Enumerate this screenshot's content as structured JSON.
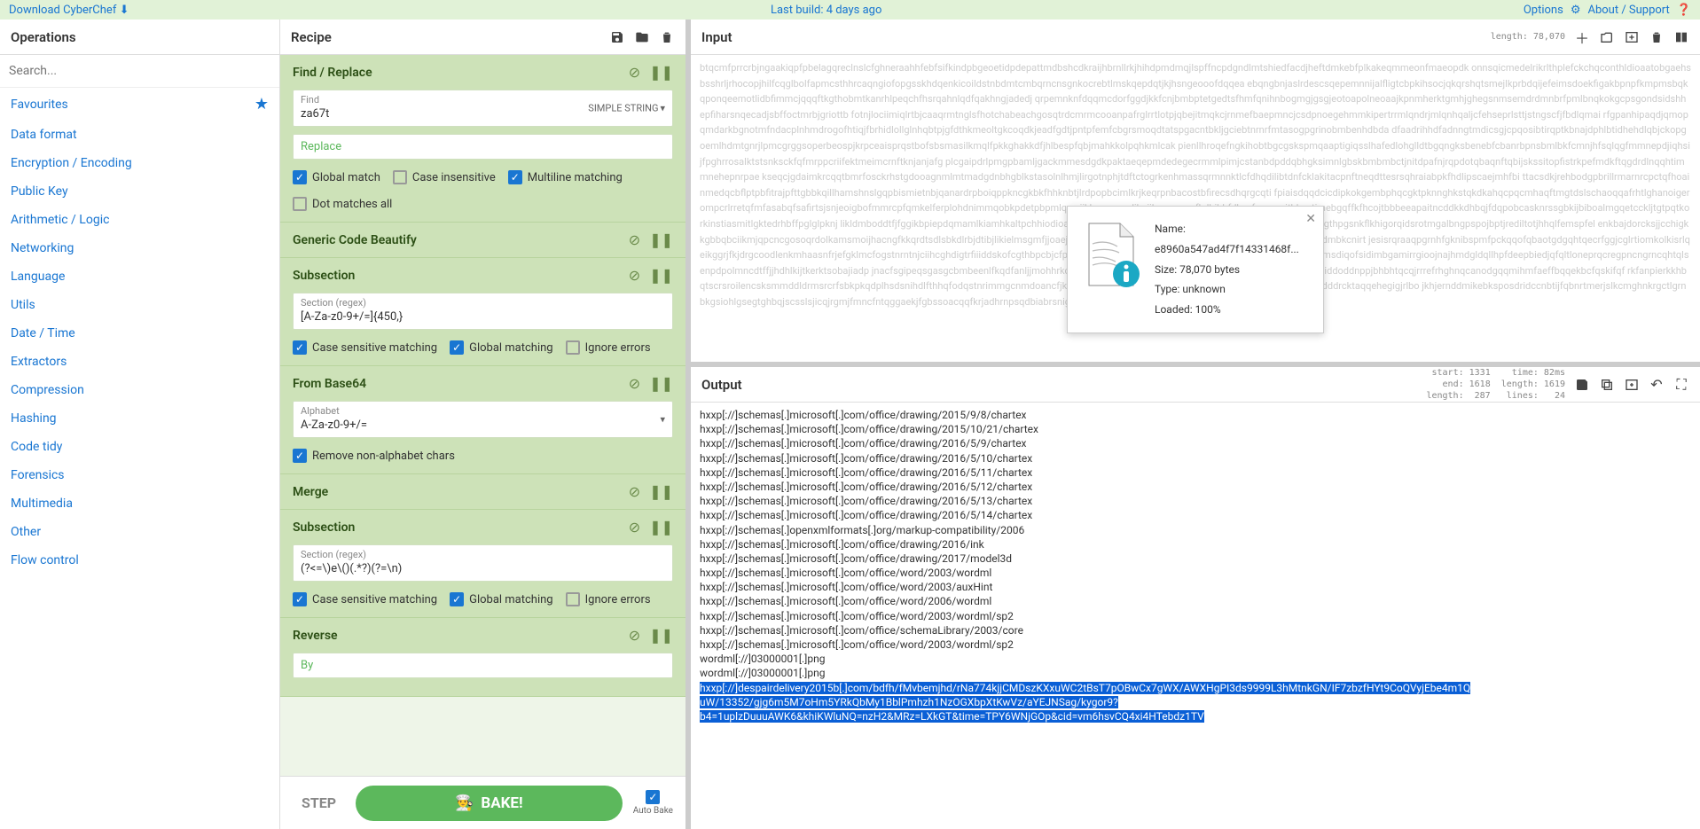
{
  "topbar": {
    "download": "Download CyberChef",
    "last_build": "Last build: 4 days ago",
    "options": "Options",
    "about": "About / Support"
  },
  "ops": {
    "title": "Operations",
    "search_placeholder": "Search...",
    "categories": [
      "Favourites",
      "Data format",
      "Encryption / Encoding",
      "Public Key",
      "Arithmetic / Logic",
      "Networking",
      "Language",
      "Utils",
      "Date / Time",
      "Extractors",
      "Compression",
      "Hashing",
      "Code tidy",
      "Forensics",
      "Multimedia",
      "Other",
      "Flow control"
    ]
  },
  "recipe": {
    "title": "Recipe",
    "ops": [
      {
        "name": "Find / Replace",
        "fields": [
          {
            "label": "Find",
            "value": "za67t",
            "dropdown": "SIMPLE STRING"
          },
          {
            "label": "Replace",
            "value": "",
            "placeholder": "Replace"
          }
        ],
        "checks": [
          {
            "label": "Global match",
            "checked": true
          },
          {
            "label": "Case insensitive",
            "checked": false
          },
          {
            "label": "Multiline matching",
            "checked": true
          },
          {
            "label": "Dot matches all",
            "checked": false
          }
        ]
      },
      {
        "name": "Generic Code Beautify",
        "collapsed": true
      },
      {
        "name": "Subsection",
        "fields": [
          {
            "label": "Section (regex)",
            "value": "[A-Za-z0-9+/=]{450,}"
          }
        ],
        "checks": [
          {
            "label": "Case sensitive matching",
            "checked": true
          },
          {
            "label": "Global matching",
            "checked": true
          },
          {
            "label": "Ignore errors",
            "checked": false
          }
        ]
      },
      {
        "name": "From Base64",
        "fields": [
          {
            "label": "Alphabet",
            "value": "A-Za-z0-9+/=",
            "dropdown": ""
          }
        ],
        "checks": [
          {
            "label": "Remove non-alphabet chars",
            "checked": true
          }
        ]
      },
      {
        "name": "Merge",
        "collapsed": true
      },
      {
        "name": "Subsection",
        "fields": [
          {
            "label": "Section (regex)",
            "value": "(?<=\\)e\\()(.*?)(?=\\n)"
          }
        ],
        "checks": [
          {
            "label": "Case sensitive matching",
            "checked": true
          },
          {
            "label": "Global matching",
            "checked": true
          },
          {
            "label": "Ignore errors",
            "checked": false
          }
        ]
      },
      {
        "name": "Reverse",
        "fields": [
          {
            "label": "By",
            "value": ""
          }
        ]
      }
    ],
    "step": "STEP",
    "bake": "BAKE!",
    "autobake": "Auto Bake"
  },
  "input": {
    "title": "Input",
    "meta": "length: 78,070",
    "popup": {
      "name_label": "Name:",
      "name": "e8960a547ad4f7f14331468f...",
      "size_label": "Size:",
      "size": "78,070 bytes",
      "type_label": "Type:",
      "type": "unknown",
      "loaded_label": "Loaded:",
      "loaded": "100%"
    }
  },
  "output": {
    "title": "Output",
    "meta": "start: 1331    time: 82ms\n  end: 1618  length: 1619\nlength:  287   lines:   24",
    "lines": [
      "hxxp[://]schemas[.]microsoft[.]com/office/drawing/2015/9/8/chartex",
      "hxxp[://]schemas[.]microsoft[.]com/office/drawing/2015/10/21/chartex",
      "hxxp[://]schemas[.]microsoft[.]com/office/drawing/2016/5/9/chartex",
      "hxxp[://]schemas[.]microsoft[.]com/office/drawing/2016/5/10/chartex",
      "hxxp[://]schemas[.]microsoft[.]com/office/drawing/2016/5/11/chartex",
      "hxxp[://]schemas[.]microsoft[.]com/office/drawing/2016/5/12/chartex",
      "hxxp[://]schemas[.]microsoft[.]com/office/drawing/2016/5/13/chartex",
      "hxxp[://]schemas[.]microsoft[.]com/office/drawing/2016/5/14/chartex",
      "hxxp[://]schemas[.]openxmlformats[.]org/markup-compatibility/2006",
      "hxxp[://]schemas[.]microsoft[.]com/office/drawing/2016/ink",
      "hxxp[://]schemas[.]microsoft[.]com/office/drawing/2017/model3d",
      "hxxp[://]schemas[.]microsoft[.]com/office/word/2003/wordml",
      "hxxp[://]schemas[.]microsoft[.]com/office/word/2003/auxHint",
      "hxxp[://]schemas[.]microsoft[.]com/office/word/2006/wordml",
      "hxxp[://]schemas[.]microsoft[.]com/office/word/2003/wordml/sp2",
      "hxxp[://]schemas[.]microsoft[.]com/office/schemaLibrary/2003/core",
      "hxxp[://]schemas[.]microsoft[.]com/office/word/2003/wordml/sp2",
      "wordml[://]03000001[.]png",
      "wordml[://]03000001[.]png"
    ],
    "highlight": "hxxp[://]despairdelivery2015b[.]com/bdfh/fMvbemjhd/rNa774kjjCMDszKXxuWC2tBsT7pOBwCx7gWX/AWXHgPI3ds9999L3hMtnkGN/IF7zbzfHYt9CoQVyjEbe4m1Q\nuW/13352/gjg6m5M7oHm5YRkQbMy1BblPmhzh1NzOGXbpXtKwVz/aYEJNSag/kygor9?\nb4=1uplzDuuuAWK6&khiKWluNQ=nzH2&MRz=LXkGT&time=TPY6WNjGOp&cid=vm6hsvCQ4xi4HTebdz1TV"
  }
}
